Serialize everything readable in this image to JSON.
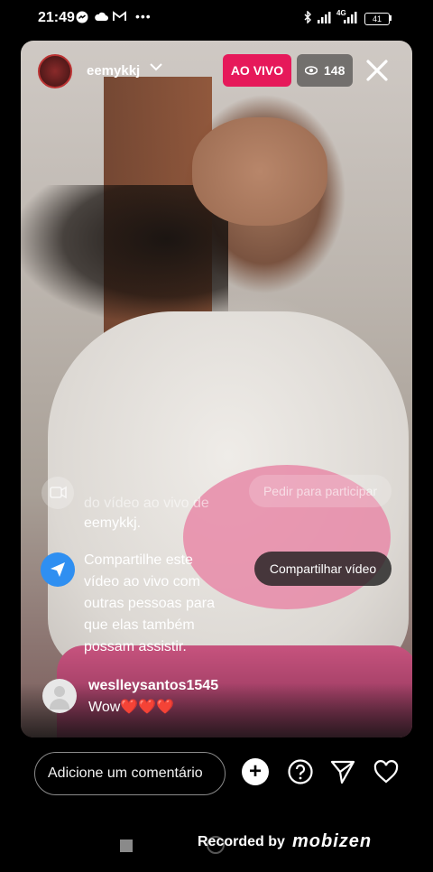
{
  "status_bar": {
    "time": "21:49",
    "network": "4G",
    "battery": "41"
  },
  "live": {
    "username": "eemykkj",
    "live_label": "AO VIVO",
    "viewer_count": "148"
  },
  "system_comments": {
    "faded_line1": "do vídeo ao vivo de",
    "faded_line2": "eemykkj.",
    "request_button": "Pedir para participar",
    "share_text_lines": [
      "Compartilhe este",
      "vídeo ao vivo com",
      "outras pessoas para",
      "que elas também",
      "possam assistir."
    ],
    "share_button": "Compartilhar vídeo"
  },
  "comment": {
    "user": "weslleysantos1545",
    "text": "Wow",
    "hearts": "❤️❤️❤️"
  },
  "bottom_bar": {
    "comment_placeholder": "Adicione um comentário"
  },
  "recorder": {
    "label": "Recorded by",
    "brand": "mobizen"
  },
  "colors": {
    "live_badge": "#e6195a",
    "share_icon": "#2f8ff1"
  }
}
